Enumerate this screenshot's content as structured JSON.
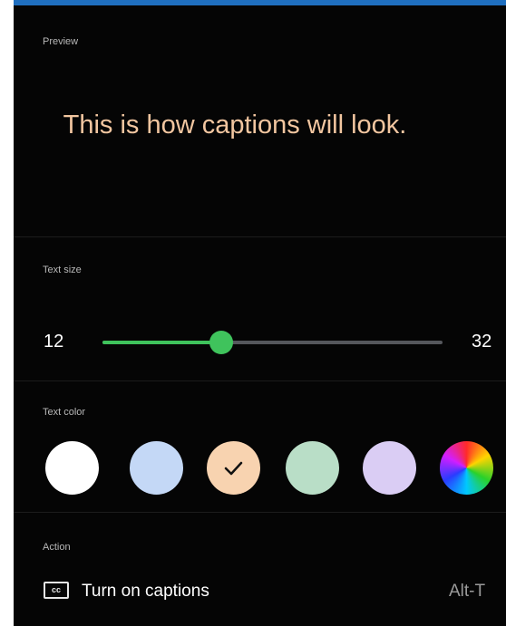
{
  "preview": {
    "label": "Preview",
    "text": "This is how captions will look."
  },
  "text_size": {
    "label": "Text size",
    "min_label": "12",
    "max_label": "32",
    "min": 12,
    "max": 32,
    "value": 19
  },
  "text_color": {
    "label": "Text color",
    "options": [
      {
        "name": "white",
        "color": "#ffffff",
        "selected": false
      },
      {
        "name": "light-blue",
        "color": "#c4d8f6",
        "selected": false
      },
      {
        "name": "peach",
        "color": "#f8d3b0",
        "selected": true
      },
      {
        "name": "light-green",
        "color": "#b9dec7",
        "selected": false
      },
      {
        "name": "lavender",
        "color": "#dacdf4",
        "selected": false
      },
      {
        "name": "custom-color",
        "color": "multicolor",
        "selected": false
      }
    ]
  },
  "action": {
    "label": "Action",
    "icon": "cc-icon",
    "icon_text": "cc",
    "item_label": "Turn on captions",
    "shortcut": "Alt-T"
  },
  "colors": {
    "accent": "#3fc35c",
    "preview_text": "#f2c6a0",
    "background": "#050505",
    "top_bar": "#1f6fc0"
  }
}
